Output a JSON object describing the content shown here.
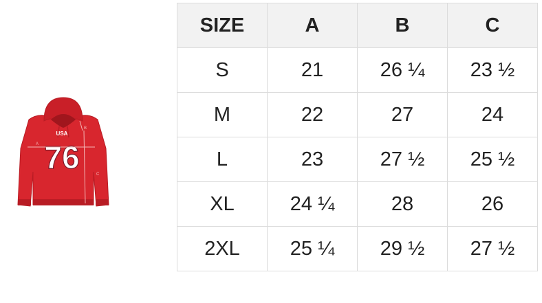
{
  "colors": {
    "garment": "#d8262e",
    "garment_shadow": "#b81c24",
    "print_fill": "#ffffff",
    "measure_lines": "#f3b7b7",
    "header_bg": "#f2f2f2",
    "border": "#dcdcdc",
    "text": "#222222"
  },
  "figure": {
    "icon": "hoodie-illustration",
    "chest_print": "USA",
    "number_print": "76",
    "marker_a": "A",
    "marker_b": "B",
    "marker_c": "C"
  },
  "size_chart": {
    "headers": [
      "SIZE",
      "A",
      "B",
      "C"
    ],
    "rows": [
      [
        "S",
        "21",
        "26 ¼",
        "23 ½"
      ],
      [
        "M",
        "22",
        "27",
        "24"
      ],
      [
        "L",
        "23",
        "27 ½",
        "25 ½"
      ],
      [
        "XL",
        "24 ¼",
        "28",
        "26"
      ],
      [
        "2XL",
        "25 ¼",
        "29 ½",
        "27 ½"
      ]
    ]
  }
}
